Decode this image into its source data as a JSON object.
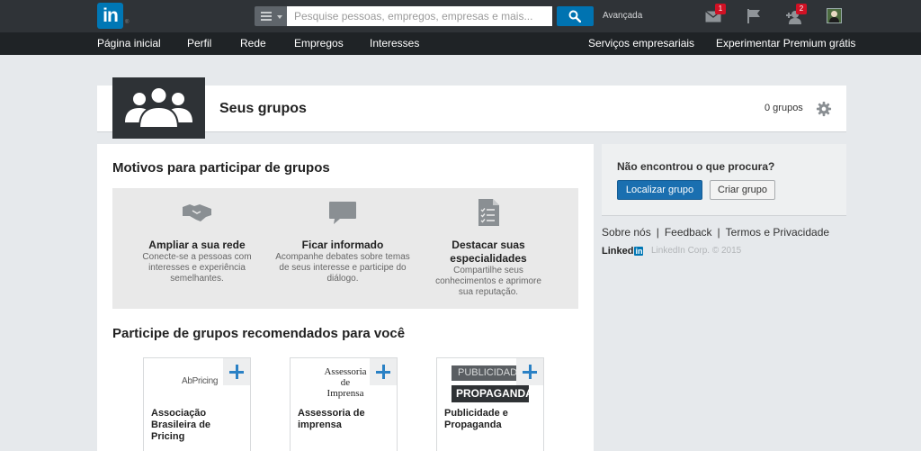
{
  "topbar": {
    "logo_text": "in",
    "logo_reg": "®",
    "search_placeholder": "Pesquise pessoas, empregos, empresas e mais...",
    "advanced": "Avançada",
    "messages_badge": "1",
    "connections_badge": "2"
  },
  "subnav": {
    "left": [
      "Página inicial",
      "Perfil",
      "Rede",
      "Empregos",
      "Interesses"
    ],
    "right": [
      "Serviços empresariais",
      "Experimentar Premium grátis"
    ]
  },
  "header": {
    "title": "Seus grupos",
    "count": "0 grupos"
  },
  "reasons_section": {
    "title": "Motivos para participar de grupos",
    "items": [
      {
        "icon": "handshake-icon",
        "title": "Ampliar a sua rede",
        "desc": "Conecte-se a pessoas com interesses e experiência semelhantes."
      },
      {
        "icon": "speech-bubble-icon",
        "title": "Ficar informado",
        "desc": "Acompanhe debates sobre temas de seus interesse e participe do diálogo."
      },
      {
        "icon": "document-icon",
        "title": "Destacar suas especialidades",
        "desc": "Compartilhe seus conhecimentos e aprimore sua reputação."
      }
    ]
  },
  "recommended": {
    "title": "Participe de grupos recomendados para você",
    "groups": [
      {
        "logo_text": "AbPricing",
        "name": "Associação Brasileira de Pricing"
      },
      {
        "logo_line1": "Assessoria",
        "logo_line2": "de",
        "logo_line3": "Imprensa",
        "name": "Assessoria de imprensa"
      },
      {
        "logo_line1": "PUBLICIDADE",
        "logo_line2": "PROPAGANDA",
        "name": "Publicidade e Propaganda"
      }
    ]
  },
  "sidebar": {
    "question": "Não encontrou o que procura?",
    "find_button": "Localizar grupo",
    "create_button": "Criar grupo",
    "links": [
      "Sobre nós",
      "Feedback",
      "Termos e Privacidade"
    ],
    "footer_brand": "Linked",
    "footer_brand_in": "in",
    "copyright": "LinkedIn Corp. © 2015"
  },
  "colors": {
    "brand": "#0077b5",
    "topbar": "#2f3337",
    "subnav": "#1f2326",
    "badge": "#d11124",
    "plus": "#2a81c5"
  }
}
